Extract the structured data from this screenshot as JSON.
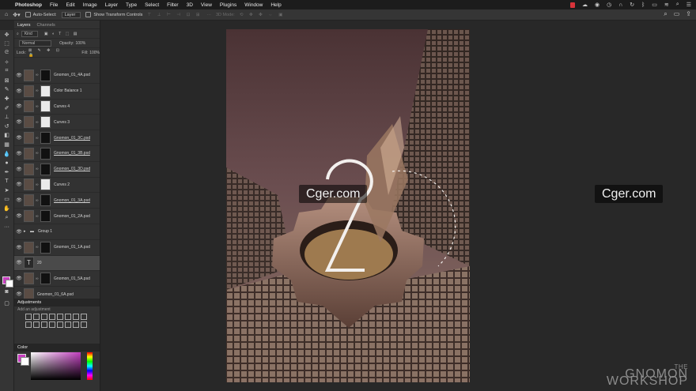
{
  "menubar": {
    "app_name": "Photoshop",
    "items": [
      "File",
      "Edit",
      "Image",
      "Layer",
      "Type",
      "Select",
      "Filter",
      "3D",
      "View",
      "Plugins",
      "Window",
      "Help"
    ]
  },
  "options_bar": {
    "auto_select_label": "Auto-Select:",
    "auto_select_value": "Layer",
    "transform_controls_label": "Show Transform Controls",
    "mode_3d_label": "3D Mode:"
  },
  "layers_panel": {
    "tabs": [
      "Layers",
      "Channels"
    ],
    "filter_kind": "Kind",
    "blend_mode": "Normal",
    "opacity_label": "Opacity:",
    "opacity_value": "100%",
    "lock_label": "Lock:",
    "fill_label": "Fill:",
    "fill_value": "100%",
    "layers": [
      {
        "name": "Gnomon_01_4A.psd",
        "kind": "img",
        "mask": true,
        "underline": false,
        "selected": false
      },
      {
        "name": "Color Balance 1",
        "kind": "adjust",
        "mask": true,
        "underline": false,
        "selected": false
      },
      {
        "name": "Curves 4",
        "kind": "adjust",
        "mask": true,
        "underline": false,
        "selected": false
      },
      {
        "name": "Curves 3",
        "kind": "adjust",
        "mask": true,
        "underline": false,
        "selected": false
      },
      {
        "name": "Gnomon_01_3C.psd",
        "kind": "img",
        "mask": true,
        "underline": true,
        "selected": false
      },
      {
        "name": "Gnomon_01_3B.psd",
        "kind": "img",
        "mask": true,
        "underline": true,
        "selected": false
      },
      {
        "name": "Gnomon_01_3D.psd",
        "kind": "img",
        "mask": true,
        "underline": true,
        "selected": false
      },
      {
        "name": "Curves 2",
        "kind": "adjust",
        "mask": true,
        "underline": false,
        "selected": false
      },
      {
        "name": "Gnomon_01_3A.psd",
        "kind": "img",
        "mask": true,
        "underline": true,
        "selected": false
      },
      {
        "name": "Gnomon_01_2A.psd",
        "kind": "img",
        "mask": true,
        "underline": false,
        "selected": false
      },
      {
        "name": "Group 1",
        "kind": "group",
        "mask": false,
        "underline": false,
        "selected": false
      },
      {
        "name": "Gnomon_01_1A.psd",
        "kind": "img",
        "mask": true,
        "underline": false,
        "selected": false
      },
      {
        "name": "20",
        "kind": "text",
        "mask": false,
        "underline": false,
        "selected": true
      },
      {
        "name": "Gnomon_01_5A.psd",
        "kind": "img",
        "mask": true,
        "underline": false,
        "selected": false
      },
      {
        "name": "Gnomon_01_6A.psd",
        "kind": "img",
        "mask": false,
        "underline": false,
        "selected": false
      }
    ]
  },
  "adjustments_panel": {
    "title": "Adjustments",
    "subtitle": "Add an adjustment"
  },
  "color_panel": {
    "title": "Color",
    "foreground": "#c83ec0",
    "background": "#ffffff"
  },
  "canvas": {
    "artwork_number": "20",
    "watermarks": [
      "Cger.com",
      "Cger.com"
    ],
    "brand_line1": "THE",
    "brand_line2": "GNOMON",
    "brand_line3": "WORKSHOP"
  }
}
